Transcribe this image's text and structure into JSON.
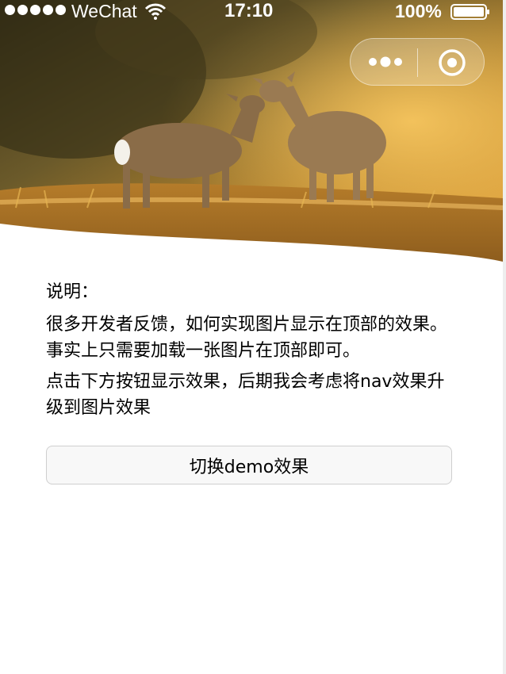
{
  "status_bar": {
    "carrier": "WeChat",
    "time": "17:10",
    "battery": "100%"
  },
  "content": {
    "title": "说明：",
    "line1": "很多开发者反馈，如何实现图片显示在顶部的效果。事实上只需要加载一张图片在顶部即可。",
    "line2": "点击下方按钮显示效果，后期我会考虑将nav效果升级到图片效果"
  },
  "button": {
    "label": "切换demo效果"
  },
  "icons": {
    "capsule_more": "more-dots-icon",
    "capsule_close": "close-circle-icon",
    "wifi": "wifi-icon",
    "battery": "battery-icon"
  }
}
